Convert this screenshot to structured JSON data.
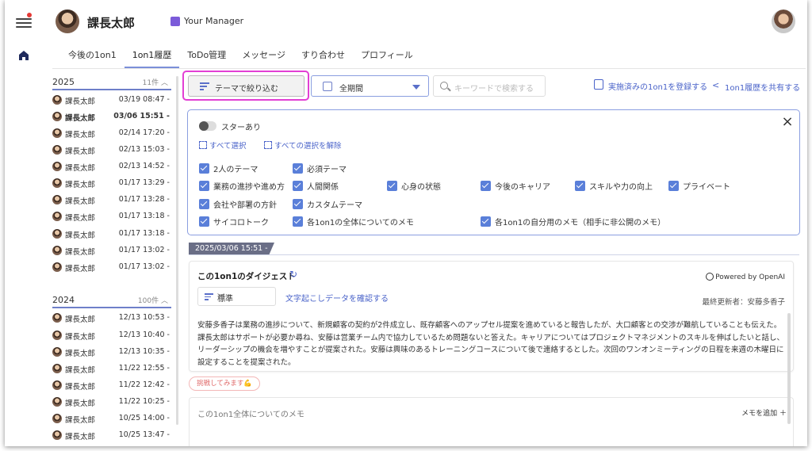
{
  "header": {
    "user_name": "課長太郎",
    "manager_label": "Your Manager"
  },
  "tabs": [
    {
      "label": "今後の1on1"
    },
    {
      "label": "1on1履歴"
    },
    {
      "label": "ToDo管理"
    },
    {
      "label": "メッセージ"
    },
    {
      "label": "すり合わせ"
    },
    {
      "label": "プロフィール"
    }
  ],
  "history": {
    "groups": [
      {
        "year": "2025",
        "count": "11件",
        "items": [
          {
            "name": "課長太郎",
            "date": "03/19 08:47 -"
          },
          {
            "name": "課長太郎",
            "date": "03/06 15:51 -"
          },
          {
            "name": "課長太郎",
            "date": "02/14 17:20 -"
          },
          {
            "name": "課長太郎",
            "date": "02/13 15:03 -"
          },
          {
            "name": "課長太郎",
            "date": "02/13 14:52 -"
          },
          {
            "name": "課長太郎",
            "date": "01/17 13:29 -"
          },
          {
            "name": "課長太郎",
            "date": "01/17 13:28 -"
          },
          {
            "name": "課長太郎",
            "date": "01/17 13:18 -"
          },
          {
            "name": "課長太郎",
            "date": "01/17 13:18 -"
          },
          {
            "name": "課長太郎",
            "date": "01/17 13:02 -"
          },
          {
            "name": "課長太郎",
            "date": "01/17 13:02 -"
          }
        ]
      },
      {
        "year": "2024",
        "count": "100件",
        "items": [
          {
            "name": "課長太郎",
            "date": "12/13 10:53 -"
          },
          {
            "name": "課長太郎",
            "date": "12/13 10:40 -"
          },
          {
            "name": "課長太郎",
            "date": "12/13 10:35 -"
          },
          {
            "name": "課長太郎",
            "date": "11/22 12:55 -"
          },
          {
            "name": "課長太郎",
            "date": "11/22 12:42 -"
          },
          {
            "name": "課長太郎",
            "date": "11/22 10:25 -"
          },
          {
            "name": "課長太郎",
            "date": "10/25 14:00 -"
          },
          {
            "name": "課長太郎",
            "date": "10/25 13:47 -"
          }
        ]
      }
    ]
  },
  "toolbar": {
    "filter_label": "テーマで絞り込む",
    "period_value": "全期間",
    "search_placeholder": "キーワードで検索する",
    "register_label": "実施済みの1on1を登録する",
    "share_label": "1on1履歴を共有する"
  },
  "filter_panel": {
    "star_label": "スターあり",
    "select_all": "すべて選択",
    "deselect_all": "すべての選択を解除",
    "themes": [
      "2人のテーマ",
      "必須テーマ",
      "業務の進捗や進め方",
      "人間関係",
      "心身の状態",
      "今後のキャリア",
      "スキルや力の向上",
      "プライベート",
      "会社や部署の方針",
      "カスタムテーマ",
      "サイコロトーク",
      "各1on1の全体についてのメモ",
      "各1on1の自分用のメモ（相手に非公開のメモ）"
    ]
  },
  "session": {
    "date_tag": "2025/03/06 15:51 -",
    "digest_title": "この1on1のダイジェスト",
    "powered_by": "Powered by OpenAI",
    "mode_value": "標準",
    "transcript_link": "文字起こしデータを確認する",
    "last_updated": "最終更新者：安藤多香子",
    "summary": "安藤多香子は業務の進捗について、新規顧客の契約が2件成立し、既存顧客へのアップセル提案を進めていると報告したが、大口顧客との交渉が難航していることも伝えた。課長太郎はサポートが必要か尋ね、安藤は営業チーム内で協力しているため問題ないと答えた。キャリアについてはプロジェクトマネジメントのスキルを伸ばしたいと話し、リーダーシップの機会を増やすことが提案された。安藤は興味のあるトレーニングコースについて後で連絡するとした。次回のワンオンミーティングの日程を来週の木曜日に設定することを提案された。",
    "challenge_badge": "挑戦してみます💪",
    "memo_title": "この1on1全体についてのメモ",
    "memo_add": "メモを追加 ＋"
  },
  "colors": {
    "accent": "#4a63c9",
    "highlight": "#e23fd4",
    "checkbox": "#5a7fd9"
  }
}
